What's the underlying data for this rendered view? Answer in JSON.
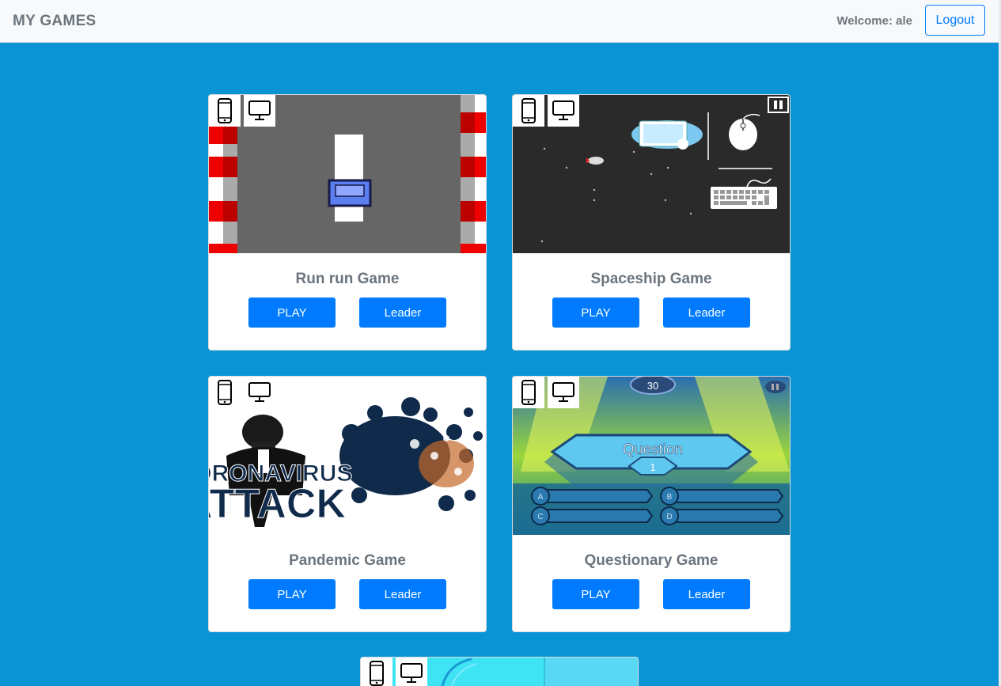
{
  "navbar": {
    "brand": "MY GAMES",
    "welcome": "Welcome: ale",
    "logout_label": "Logout"
  },
  "games": [
    {
      "title": "Run run Game",
      "play_label": "PLAY",
      "leader_label": "Leader"
    },
    {
      "title": "Spaceship Game",
      "play_label": "PLAY",
      "leader_label": "Leader"
    },
    {
      "title": "Pandemic Game",
      "play_label": "PLAY",
      "leader_label": "Leader"
    },
    {
      "title": "Questionary Game",
      "play_label": "PLAY",
      "leader_label": "Leader"
    }
  ],
  "thumbnails": {
    "pandemic_line1": "CORONAVIRUS",
    "pandemic_line2": "ATTACK",
    "question_label": "Question",
    "question_number": "1",
    "timer": "30",
    "answers": [
      "A",
      "B",
      "C",
      "D"
    ]
  },
  "icons": {
    "platforms": [
      "phone-icon",
      "desktop-icon"
    ]
  },
  "colors": {
    "background": "#0a94d6",
    "accent": "#007bff",
    "navbar": "#f8f9fa"
  }
}
